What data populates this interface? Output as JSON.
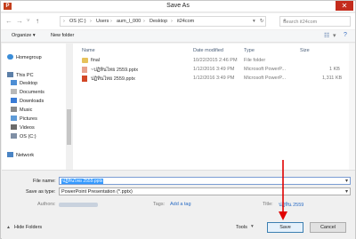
{
  "window": {
    "title": "Save As",
    "app_icon": "P"
  },
  "nav": {
    "back": "←",
    "forward": "→",
    "up": "↑",
    "recent": "˅"
  },
  "address": {
    "crumbs": [
      "OS (C:)",
      "Users",
      "aum_l_000",
      "Desktop",
      "it24com"
    ],
    "separator": "›"
  },
  "search": {
    "placeholder": "Search it24com"
  },
  "toolbar": {
    "organize": "Organize ▾",
    "new_folder": "New folder"
  },
  "sidebar": {
    "items": [
      {
        "label": "Homegroup",
        "color": "#3a8dd8"
      },
      {
        "label": "This PC",
        "color": "#5c7fa8"
      },
      {
        "label": "Desktop",
        "color": "#4d8ed4"
      },
      {
        "label": "Documents",
        "color": "#8a8a8a"
      },
      {
        "label": "Downloads",
        "color": "#3a7bd5"
      },
      {
        "label": "Music",
        "color": "#7a7a7a"
      },
      {
        "label": "Pictures",
        "color": "#5f9bd7"
      },
      {
        "label": "Videos",
        "color": "#6b6b6b"
      },
      {
        "label": "OS (C:)",
        "color": "#7f8fa5"
      },
      {
        "label": "Network",
        "color": "#4a84c4"
      }
    ]
  },
  "files": {
    "headers": {
      "name": "Name",
      "date": "Date modified",
      "type": "Type",
      "size": "Size"
    },
    "rows": [
      {
        "name": "final",
        "date": "10/22/2015 2:46 PM",
        "type": "File folder",
        "size": "",
        "kind": "folder"
      },
      {
        "name": "~ปฏิทินไทย 2559.pptx",
        "date": "1/12/2016 3:49 PM",
        "type": "Microsoft PowerP...",
        "size": "1 KB",
        "kind": "temp"
      },
      {
        "name": "ปฏิทินไทย 2559.pptx",
        "date": "1/12/2016 3:49 PM",
        "type": "Microsoft PowerP...",
        "size": "1,311 KB",
        "kind": "ppt"
      }
    ]
  },
  "form": {
    "file_name_label": "File name:",
    "file_name_value": "ปฏิทินไทย 2559.pptx",
    "save_type_label": "Save as type:",
    "save_type_value": "PowerPoint Presentation (*.pptx)",
    "authors_label": "Authors:",
    "tags_label": "Tags:",
    "tags_link": "Add a tag",
    "title_label": "Title:",
    "title_value": "ปฏิทิน 2559"
  },
  "buttons": {
    "tools": "Tools",
    "save": "Save",
    "cancel": "Cancel",
    "hide_folders": "Hide Folders"
  },
  "colors": {
    "accent": "#3399ff",
    "close": "#c42b1c",
    "annotation_arrow": "#e00000"
  }
}
